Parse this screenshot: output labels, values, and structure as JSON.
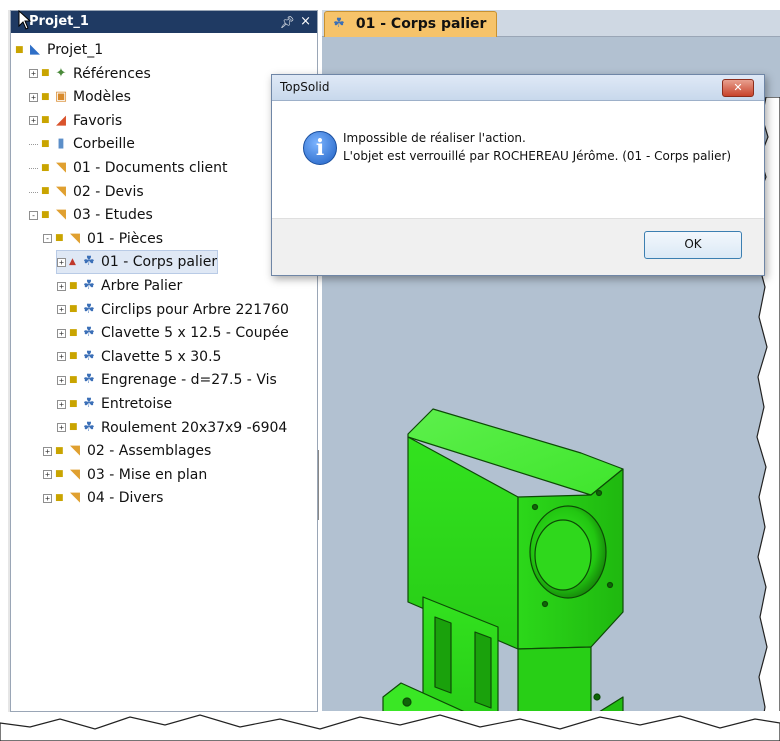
{
  "tree_panel": {
    "title": "Projet_1",
    "pin_icon": "pin-icon",
    "close_icon": "close-icon",
    "items": [
      {
        "label": "Projet_1",
        "icon": "project-icon",
        "indent": 0,
        "expander": ""
      },
      {
        "label": "Références",
        "icon": "references-icon",
        "indent": 1,
        "expander": "+"
      },
      {
        "label": "Modèles",
        "icon": "models-icon",
        "indent": 1,
        "expander": "+"
      },
      {
        "label": "Favoris",
        "icon": "favorites-icon",
        "indent": 1,
        "expander": "+"
      },
      {
        "label": "Corbeille",
        "icon": "recycle-bin-icon",
        "indent": 1,
        "expander": ""
      },
      {
        "label": "01 - Documents client",
        "icon": "folder-icon",
        "indent": 1,
        "expander": ""
      },
      {
        "label": "02 - Devis",
        "icon": "folder-icon",
        "indent": 1,
        "expander": ""
      },
      {
        "label": "03 - Etudes",
        "icon": "folder-icon",
        "indent": 1,
        "expander": "-"
      },
      {
        "label": "01 - Pièces",
        "icon": "folder-icon",
        "indent": 2,
        "expander": "-"
      },
      {
        "label": "01 - Corps palier",
        "icon": "part-icon",
        "indent": 3,
        "expander": "+",
        "selected": true
      },
      {
        "label": "Arbre Palier",
        "icon": "part-icon",
        "indent": 3,
        "expander": "+"
      },
      {
        "label": "Circlips pour Arbre 221760",
        "icon": "part-icon",
        "indent": 3,
        "expander": "+"
      },
      {
        "label": "Clavette 5 x  12.5 - Coupée",
        "icon": "part-icon",
        "indent": 3,
        "expander": "+"
      },
      {
        "label": "Clavette 5 x 30.5",
        "icon": "part-icon",
        "indent": 3,
        "expander": "+"
      },
      {
        "label": "Engrenage - d=27.5 - Vis",
        "icon": "part-icon",
        "indent": 3,
        "expander": "+"
      },
      {
        "label": "Entretoise",
        "icon": "part-icon",
        "indent": 3,
        "expander": "+"
      },
      {
        "label": "Roulement 20x37x9 -6904",
        "icon": "part-icon",
        "indent": 3,
        "expander": "+"
      },
      {
        "label": "02 - Assemblages",
        "icon": "folder-icon",
        "indent": 2,
        "expander": "+"
      },
      {
        "label": "03 - Mise en plan",
        "icon": "folder-icon",
        "indent": 2,
        "expander": "+"
      },
      {
        "label": "04 - Divers",
        "icon": "folder-icon",
        "indent": 2,
        "expander": "+"
      }
    ]
  },
  "document": {
    "tab_label": "01 - Corps palier",
    "tab_icon": "part-icon",
    "model_color": "#33e21f"
  },
  "dialog": {
    "title": "TopSolid",
    "icon": "info-icon",
    "message_line1": "Impossible de réaliser l'action.",
    "message_line2": "L'objet est verrouillé par ROCHEREAU Jérôme. (01 - Corps palier)",
    "ok_label": "OK"
  },
  "colors": {
    "panel_header": "#1f3a63",
    "tab_active": "#f6c36a",
    "viewport_bg": "#b2c1d1",
    "dialog_close": "#c8432b"
  }
}
